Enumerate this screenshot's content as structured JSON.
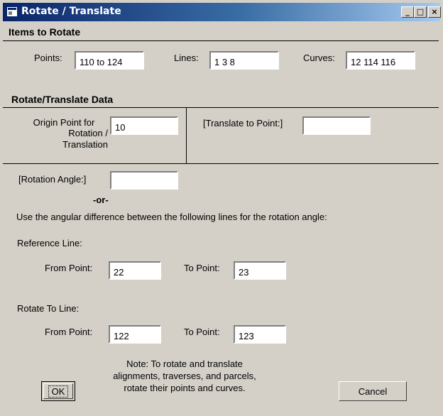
{
  "window": {
    "title": "Rotate / Translate",
    "minimize": "_",
    "maximize": "□",
    "close": "×"
  },
  "items_section": {
    "heading": "Items to Rotate",
    "points_label": "Points:",
    "points_value": "110 to 124",
    "lines_label": "Lines:",
    "lines_value": "1 3 8",
    "curves_label": "Curves:",
    "curves_value": "12 114 116"
  },
  "data_section": {
    "heading": "Rotate/Translate Data",
    "origin_label_1": "Origin Point for",
    "origin_label_2": "Rotation /",
    "origin_label_3": "Translation",
    "origin_value": "10",
    "translate_label": "[Translate to Point:]",
    "translate_value": ""
  },
  "rotation": {
    "angle_label": "[Rotation Angle:]",
    "angle_value": "",
    "or_text": "-or-",
    "instructions": "Use the angular difference between the following lines for the rotation angle:",
    "reference_line_label": "Reference Line:",
    "ref_from_label": "From Point:",
    "ref_from_value": "22",
    "ref_to_label": "To Point:",
    "ref_to_value": "23",
    "rotate_to_line_label": "Rotate To Line:",
    "rot_from_label": "From Point:",
    "rot_from_value": "122",
    "rot_to_label": "To Point:",
    "rot_to_value": "123"
  },
  "note": {
    "line1": "Note: To rotate and translate",
    "line2": "alignments, traverses, and parcels,",
    "line3": "rotate their points and curves."
  },
  "buttons": {
    "ok": "OK",
    "cancel": "Cancel"
  },
  "colors": {
    "titlebar_start": "#0a246a",
    "titlebar_end": "#a6caf0",
    "dialog_face": "#d4d0c8"
  }
}
